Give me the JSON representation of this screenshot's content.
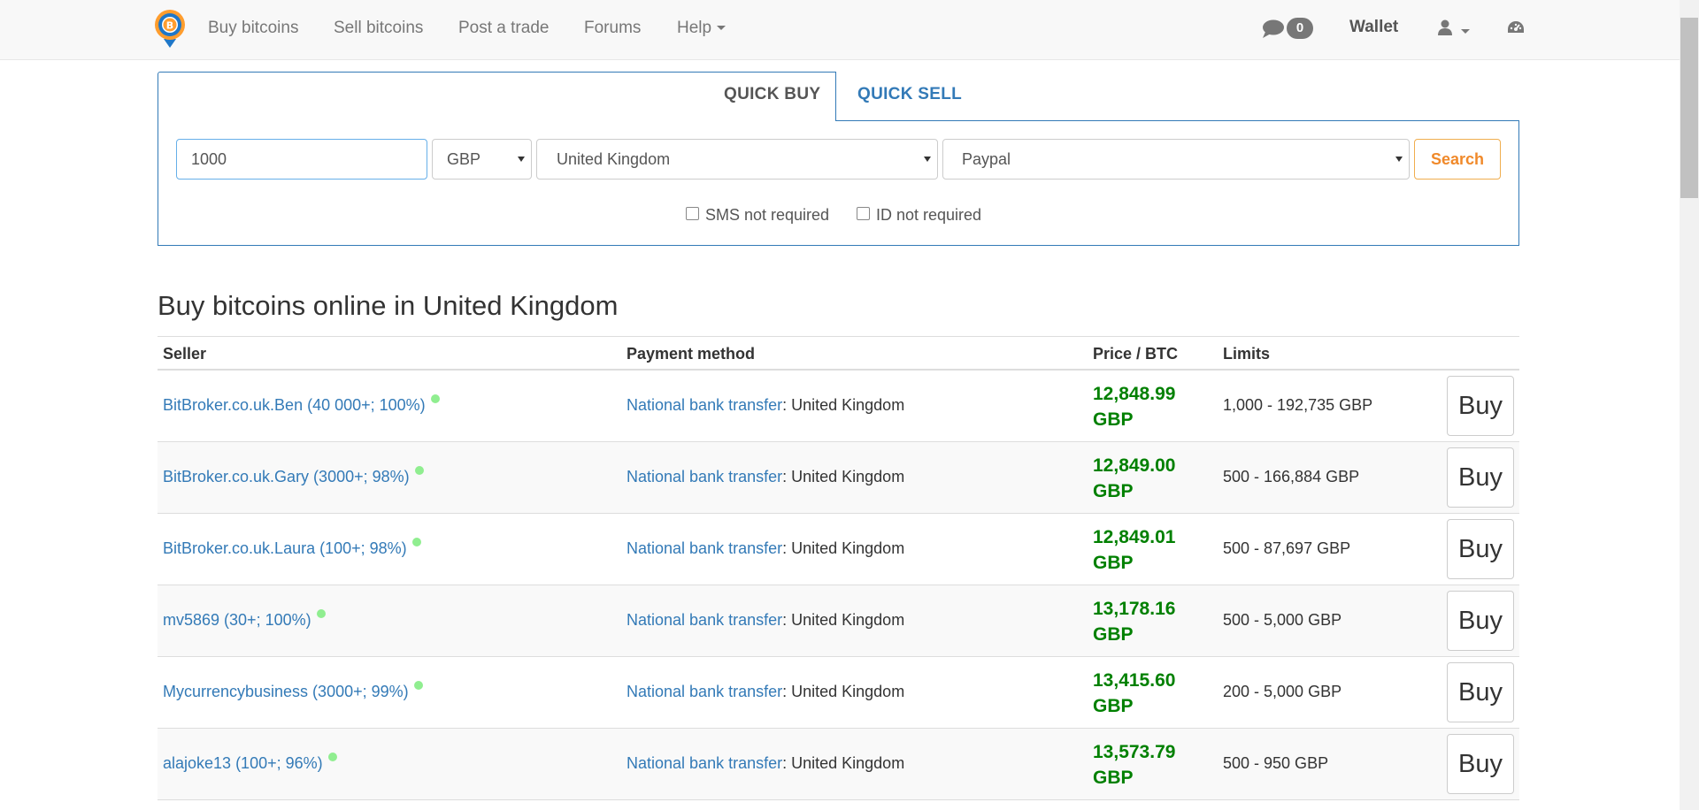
{
  "nav": {
    "links": [
      "Buy bitcoins",
      "Sell bitcoins",
      "Post a trade",
      "Forums",
      "Help"
    ],
    "message_count": "0",
    "wallet": "Wallet"
  },
  "quick": {
    "tab_buy": "QUICK BUY",
    "tab_sell": "QUICK SELL",
    "amount": "1000",
    "currency": "GBP",
    "country": "United Kingdom",
    "payment_method": "Paypal",
    "search_label": "Search",
    "sms_label": "SMS not required",
    "id_label": "ID not required"
  },
  "heading": "Buy bitcoins online in United Kingdom",
  "table": {
    "headers": [
      "Seller",
      "Payment method",
      "Price / BTC",
      "Limits"
    ],
    "buy_label": "Buy",
    "rows": [
      {
        "seller": "BitBroker.co.uk.Ben (40 000+; 100%)",
        "method": "National bank transfer",
        "location": ": United Kingdom",
        "price": "12,848.99",
        "currency": "GBP",
        "limits": "1,000 - 192,735 GBP"
      },
      {
        "seller": "BitBroker.co.uk.Gary (3000+; 98%)",
        "method": "National bank transfer",
        "location": ": United Kingdom",
        "price": "12,849.00",
        "currency": "GBP",
        "limits": "500 - 166,884 GBP"
      },
      {
        "seller": "BitBroker.co.uk.Laura (100+; 98%)",
        "method": "National bank transfer",
        "location": ": United Kingdom",
        "price": "12,849.01",
        "currency": "GBP",
        "limits": "500 - 87,697 GBP"
      },
      {
        "seller": "mv5869 (30+; 100%)",
        "method": "National bank transfer",
        "location": ": United Kingdom",
        "price": "13,178.16",
        "currency": "GBP",
        "limits": "500 - 5,000 GBP"
      },
      {
        "seller": "Mycurrencybusiness (3000+; 99%)",
        "method": "National bank transfer",
        "location": ": United Kingdom",
        "price": "13,415.60",
        "currency": "GBP",
        "limits": "200 - 5,000 GBP"
      },
      {
        "seller": "alajoke13 (100+; 96%)",
        "method": "National bank transfer",
        "location": ": United Kingdom",
        "price": "13,573.79",
        "currency": "GBP",
        "limits": "500 - 950 GBP"
      }
    ]
  },
  "colors": {
    "link": "#337ab7",
    "price": "#008000",
    "search": "#f0892a",
    "online": "#90ee90"
  }
}
